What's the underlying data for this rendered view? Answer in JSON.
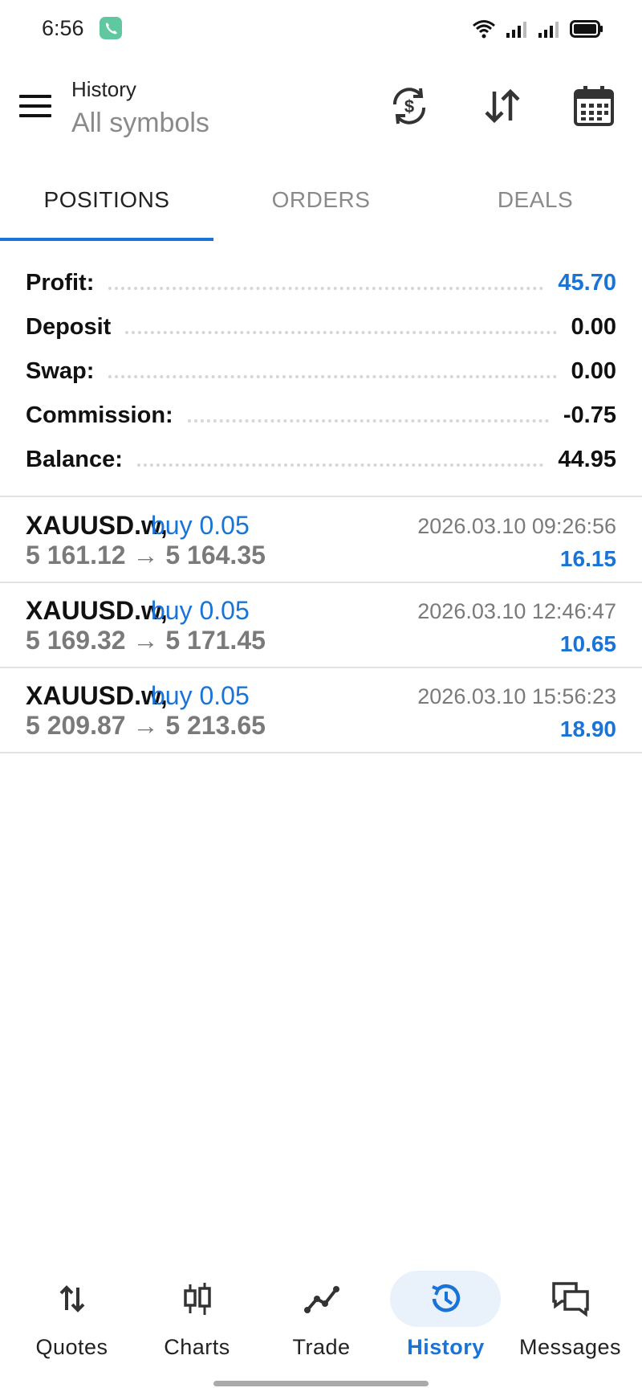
{
  "status_bar": {
    "time": "6:56",
    "icons": [
      "call-icon",
      "wifi-icon",
      "signal-icon",
      "signal-icon",
      "battery-icon"
    ]
  },
  "header": {
    "title": "History",
    "subtitle": "All symbols",
    "actions": [
      "currency-refresh-icon",
      "sort-icon",
      "calendar-icon"
    ]
  },
  "tabs": [
    {
      "label": "POSITIONS",
      "active": true
    },
    {
      "label": "ORDERS",
      "active": false
    },
    {
      "label": "DEALS",
      "active": false
    }
  ],
  "summary": {
    "profit_label": "Profit:",
    "profit_value": "45.70",
    "deposit_label": "Deposit",
    "deposit_value": "0.00",
    "swap_label": "Swap:",
    "swap_value": "0.00",
    "commission_label": "Commission:",
    "commission_value": "-0.75",
    "balance_label": "Balance:",
    "balance_value": "44.95"
  },
  "positions": [
    {
      "symbol": "XAUUSD.w,",
      "type": "buy 0.05",
      "prices": "5 161.12 → 5 164.35",
      "time": "2026.03.10 09:26:56",
      "profit": "16.15"
    },
    {
      "symbol": "XAUUSD.w,",
      "type": "buy 0.05",
      "prices": "5 169.32 → 5 171.45",
      "time": "2026.03.10 12:46:47",
      "profit": "10.65"
    },
    {
      "symbol": "XAUUSD.w,",
      "type": "buy 0.05",
      "prices": "5 209.87 → 5 213.65",
      "time": "2026.03.10 15:56:23",
      "profit": "18.90"
    }
  ],
  "bottom_nav": [
    {
      "label": "Quotes",
      "icon": "quotes-icon",
      "active": false
    },
    {
      "label": "Charts",
      "icon": "candlestick-icon",
      "active": false
    },
    {
      "label": "Trade",
      "icon": "trade-icon",
      "active": false
    },
    {
      "label": "History",
      "icon": "history-icon",
      "active": true
    },
    {
      "label": "Messages",
      "icon": "messages-icon",
      "active": false
    }
  ],
  "colors": {
    "accent": "#1a73d6",
    "muted": "#8a8a8a",
    "divider": "#e2e2e2"
  }
}
